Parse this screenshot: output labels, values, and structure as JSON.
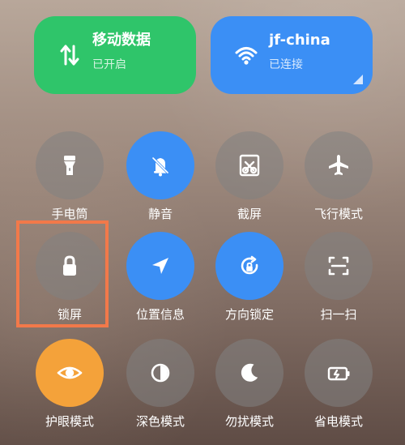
{
  "tiles": {
    "mobile_data": {
      "title": "移动数据",
      "status": "已开启",
      "icon": "data-transfer-arrows-icon",
      "color": "#2fc56a"
    },
    "wifi": {
      "title": "jf-china",
      "status": "已连接",
      "icon": "wifi-icon",
      "color": "#3b8ff5"
    }
  },
  "toggles": [
    {
      "label": "手电筒",
      "icon": "flashlight-icon",
      "state": "off"
    },
    {
      "label": "静音",
      "icon": "mute-bell-icon",
      "state": "on",
      "color": "#3b8ff5"
    },
    {
      "label": "截屏",
      "icon": "screenshot-icon",
      "state": "off"
    },
    {
      "label": "飞行模式",
      "icon": "airplane-icon",
      "state": "off"
    },
    {
      "label": "锁屏",
      "icon": "lock-icon",
      "state": "off",
      "highlighted": true,
      "highlight_color": "#f2794a"
    },
    {
      "label": "位置信息",
      "icon": "location-arrow-icon",
      "state": "on",
      "color": "#3b8ff5"
    },
    {
      "label": "方向锁定",
      "icon": "rotation-lock-icon",
      "state": "on",
      "color": "#3b8ff5"
    },
    {
      "label": "扫一扫",
      "icon": "scan-icon",
      "state": "off"
    },
    {
      "label": "护眼模式",
      "icon": "eye-icon",
      "state": "on",
      "color": "#f4a23a"
    },
    {
      "label": "深色模式",
      "icon": "dark-mode-icon",
      "state": "off"
    },
    {
      "label": "勿扰模式",
      "icon": "moon-icon",
      "state": "off"
    },
    {
      "label": "省电模式",
      "icon": "battery-saver-icon",
      "state": "off"
    }
  ]
}
